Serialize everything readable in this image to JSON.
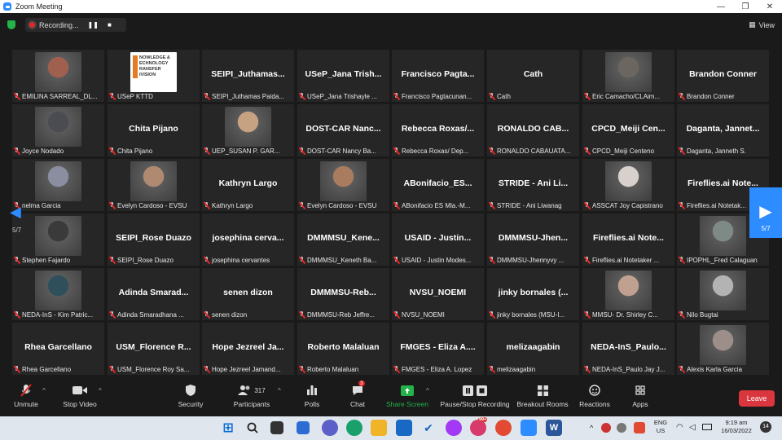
{
  "window": {
    "title": "Zoom Meeting",
    "min": "—",
    "max": "❐",
    "close": "✕"
  },
  "topbar": {
    "recording_label": "Recording...",
    "view_label": "View",
    "pause_glyph": "❚❚",
    "stop_glyph": "■"
  },
  "nav": {
    "page_left": "5/7",
    "page_right": "5/7",
    "left_arrow": "◀",
    "right_arrow": "▶"
  },
  "tiles": [
    {
      "big": "",
      "cap": "EMILINA SARREAL_DL...",
      "photo": "#a06050"
    },
    {
      "big": "",
      "cap": "USeP KTTD",
      "photo": "#f3f3f3"
    },
    {
      "big": "SEIPI_Juthamas...",
      "cap": "SEIPI_Juthamas Paida..."
    },
    {
      "big": "USeP_Jana Trish...",
      "cap": "USeP_Jana Trishayle ..."
    },
    {
      "big": "Francisco Pagta...",
      "cap": "Francisco Pagtacunan..."
    },
    {
      "big": "Cath",
      "cap": "Cath"
    },
    {
      "big": "",
      "cap": "Eric Camacho/CLAim...",
      "photo": "#6b6660"
    },
    {
      "big": "Brandon Conner",
      "cap": "Brandon Conner"
    },
    {
      "big": "",
      "cap": "Joyce Nodado",
      "photo": "#4b4b52"
    },
    {
      "big": "Chita Pijano",
      "cap": "Chita Pijano"
    },
    {
      "big": "",
      "cap": "UEP_SUSAN P. GAR...",
      "photo": "#c6a182"
    },
    {
      "big": "DOST-CAR Nanc...",
      "cap": "DOST-CAR Nancy Ba..."
    },
    {
      "big": "Rebecca Roxas/...",
      "cap": "Rebecca Roxas/ Dep..."
    },
    {
      "big": "RONALDO CAB...",
      "cap": "RONALDO CABAUATA..."
    },
    {
      "big": "CPCD_Meiji Cen...",
      "cap": "CPCD_Meiji Centeno"
    },
    {
      "big": "Daganta, Jannet...",
      "cap": "Daganta, Janneth S."
    },
    {
      "big": "",
      "cap": "nelma Garcia",
      "photo": "#8a8ea0"
    },
    {
      "big": "",
      "cap": "Evelyn Cardoso - EVSU",
      "photo": "#b08a70"
    },
    {
      "big": "Kathryn Largo",
      "cap": "Kathryn Largo"
    },
    {
      "big": "",
      "cap": "Evelyn Cardoso - EVSU",
      "photo": "#a97c60"
    },
    {
      "big": "ABonifacio_ES...",
      "cap": "ABonifacio ES Mla.-M..."
    },
    {
      "big": "STRIDE - Ani Li...",
      "cap": "STRIDE - Ani Liwanag"
    },
    {
      "big": "",
      "cap": "ASSCAT Joy Capistrano",
      "photo": "#d8d0cc"
    },
    {
      "big": "Fireflies.ai Note...",
      "cap": "Fireflies.ai Notetak..."
    },
    {
      "big": "",
      "cap": "Stephen Fajardo",
      "photo": "#3a3a3a"
    },
    {
      "big": "SEIPI_Rose Duazo",
      "cap": "SEIPI_Rose Duazo"
    },
    {
      "big": "josephina cerva...",
      "cap": "josephina cervantes"
    },
    {
      "big": "DMMMSU_Kene...",
      "cap": "DMMMSU_Keneth Ba..."
    },
    {
      "big": "USAID - Justin...",
      "cap": "USAID - Justin Modes..."
    },
    {
      "big": "DMMMSU-Jhen...",
      "cap": "DMMMSU-Jhennyvy ..."
    },
    {
      "big": "Fireflies.ai Note...",
      "cap": "Fireflies.ai Notetaker ..."
    },
    {
      "big": "",
      "cap": "IPOPHL_Fred Calaguan",
      "photo": "#7e8a86"
    },
    {
      "big": "",
      "cap": "NEDA-InS - Kim Patric...",
      "photo": "#2f4f5a"
    },
    {
      "big": "Adinda Smarad...",
      "cap": "Adinda Smaradhana ..."
    },
    {
      "big": "senen dizon",
      "cap": "senen dizon"
    },
    {
      "big": "DMMMSU-Reb...",
      "cap": "DMMMSU-Reb Jeffre..."
    },
    {
      "big": "NVSU_NOEMI",
      "cap": "NVSU_NOEMI"
    },
    {
      "big": "jinky bornales (...",
      "cap": "jinky bornales (MSU-I..."
    },
    {
      "big": "",
      "cap": "MMSU- Dr. Shirley C...",
      "photo": "#c0a090"
    },
    {
      "big": "",
      "cap": "Nilo Bugtai",
      "photo": "#b3b3b3"
    },
    {
      "big": "Rhea Garcellano",
      "cap": "Rhea Garcellano"
    },
    {
      "big": "USM_Florence R...",
      "cap": "USM_Florence Roy Sa..."
    },
    {
      "big": "Hope Jezreel Ja...",
      "cap": "Hope Jezreel Jamand..."
    },
    {
      "big": "Roberto Malaluan",
      "cap": "Roberto Malaluan"
    },
    {
      "big": "FMGES - Eliza A....",
      "cap": "FMGES - Eliza A. Lopez"
    },
    {
      "big": "melizaagabin",
      "cap": "melizaagabin"
    },
    {
      "big": "NEDA-InS_Paulo...",
      "cap": "NEDA-InS_Paulo Jay J..."
    },
    {
      "big": "",
      "cap": "Alexis Karla Garcia",
      "photo": "#9c8f8a"
    }
  ],
  "toolbar": {
    "unmute": "Unmute",
    "stop_video": "Stop Video",
    "security": "Security",
    "participants": "Participants",
    "participants_count": "317",
    "polls": "Polls",
    "chat": "Chat",
    "chat_badge": "3",
    "share_screen": "Share Screen",
    "pause_stop_recording": "Pause/Stop Recording",
    "breakout_rooms": "Breakout Rooms",
    "reactions": "Reactions",
    "apps": "Apps",
    "leave": "Leave"
  },
  "ktt_logo": {
    "text": "NOWLEDGE & ECHNOLOGY RANSFER IVISION"
  },
  "taskbar": {
    "lang_line1": "ENG",
    "lang_line2": "US",
    "time": "9:19 am",
    "date": "16/03/2022",
    "notif_count": "14",
    "chat_badge": "99+"
  }
}
